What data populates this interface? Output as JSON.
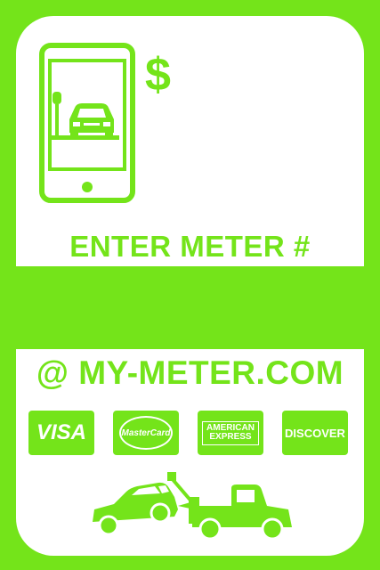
{
  "sign": {
    "currency_symbol": "$",
    "instruction": "ENTER METER #",
    "website": "@ MY-METER.COM"
  },
  "payment_cards": [
    {
      "label": "VISA"
    },
    {
      "label": "MasterCard"
    },
    {
      "label_line1": "AMERICAN",
      "label_line2": "EXPRESS"
    },
    {
      "label": "DISCOVER"
    }
  ],
  "icons": [
    "phone-icon",
    "parking-meter-icon",
    "car-icon",
    "tow-truck-icon"
  ],
  "colors": {
    "brand_green": "#74e41a",
    "panel_white": "#ffffff"
  }
}
